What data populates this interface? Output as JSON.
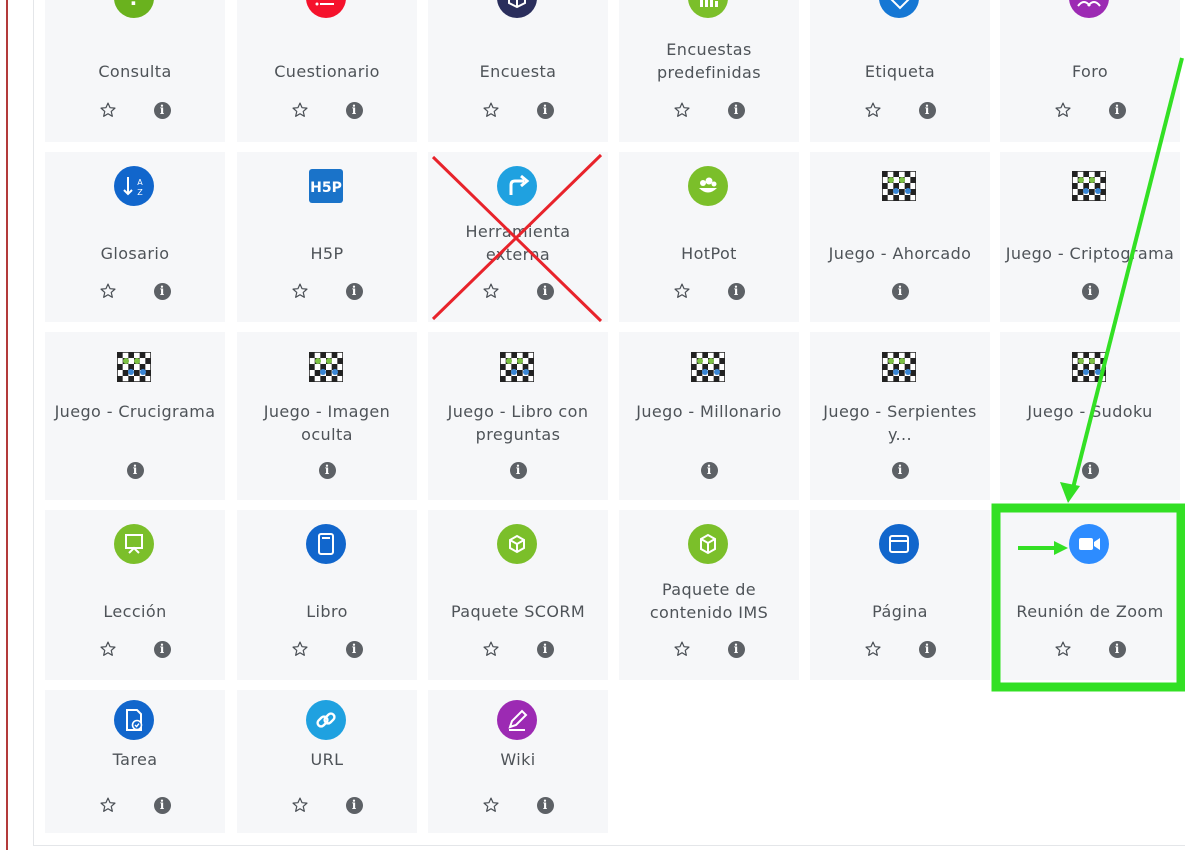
{
  "tiles": [
    {
      "label": "Consulta",
      "icon": "question-icon",
      "color": "#6ab21e",
      "star": true
    },
    {
      "label": "Cuestionario",
      "icon": "quiz-list-icon",
      "color": "#f5122c",
      "star": true
    },
    {
      "label": "Encuesta",
      "icon": "survey-box-icon",
      "color": "#2a2e5c",
      "star": true
    },
    {
      "label": "Encuestas predefinidas",
      "icon": "bar-chart-icon",
      "color": "#7bbf2a",
      "star": true
    },
    {
      "label": "Etiqueta",
      "icon": "tag-icon",
      "color": "#1577d4",
      "star": true
    },
    {
      "label": "Foro",
      "icon": "forum-people-icon",
      "color": "#9c2ab3",
      "star": true
    },
    {
      "label": "Glosario",
      "icon": "sort-az-icon",
      "color": "#1166cc",
      "star": true
    },
    {
      "label": "H5P",
      "icon": "h5p-logo-icon",
      "color": "#1a73c9",
      "star": true
    },
    {
      "label": "Herramienta externa",
      "icon": "external-arrow-icon",
      "color": "#1fa1e0",
      "star": true
    },
    {
      "label": "HotPot",
      "icon": "hotpot-icon",
      "color": "#7bbf2a",
      "star": true
    },
    {
      "label": "Juego - Ahorcado",
      "icon": "game-checkerboard-icon",
      "star": false
    },
    {
      "label": "Juego - Criptograma",
      "icon": "game-checkerboard-icon",
      "star": false
    },
    {
      "label": "Juego - Crucigrama",
      "icon": "game-checkerboard-icon",
      "star": false
    },
    {
      "label": "Juego - Imagen oculta",
      "icon": "game-checkerboard-icon",
      "star": false
    },
    {
      "label": "Juego - Libro con preguntas",
      "icon": "game-checkerboard-icon",
      "star": false
    },
    {
      "label": "Juego - Millonario",
      "icon": "game-checkerboard-icon",
      "star": false
    },
    {
      "label": "Juego - Serpientes y...",
      "icon": "game-checkerboard-icon",
      "star": false
    },
    {
      "label": "Juego - Sudoku",
      "icon": "game-checkerboard-icon",
      "star": false
    },
    {
      "label": "Lección",
      "icon": "lesson-board-icon",
      "color": "#7bbf2a",
      "star": true
    },
    {
      "label": "Libro",
      "icon": "book-icon",
      "color": "#1166cc",
      "star": true
    },
    {
      "label": "Paquete SCORM",
      "icon": "package-cube-icon",
      "color": "#7bbf2a",
      "star": true
    },
    {
      "label": "Paquete de contenido IMS",
      "icon": "ims-cube-icon",
      "color": "#7bbf2a",
      "star": true
    },
    {
      "label": "Página",
      "icon": "page-window-icon",
      "color": "#1166cc",
      "star": true
    },
    {
      "label": "Reunión de Zoom",
      "icon": "zoom-camera-icon",
      "color": "#2d8cff",
      "star": true
    },
    {
      "label": "Tarea",
      "icon": "assignment-icon",
      "color": "#1166cc",
      "star": true
    },
    {
      "label": "URL",
      "icon": "link-icon",
      "color": "#1fa1e0",
      "star": true
    },
    {
      "label": "Wiki",
      "icon": "wiki-pen-icon",
      "color": "#9c2ab3",
      "star": true
    }
  ],
  "annotations": {
    "highlight_color": "#33e024",
    "cross_color": "#e8232b"
  }
}
